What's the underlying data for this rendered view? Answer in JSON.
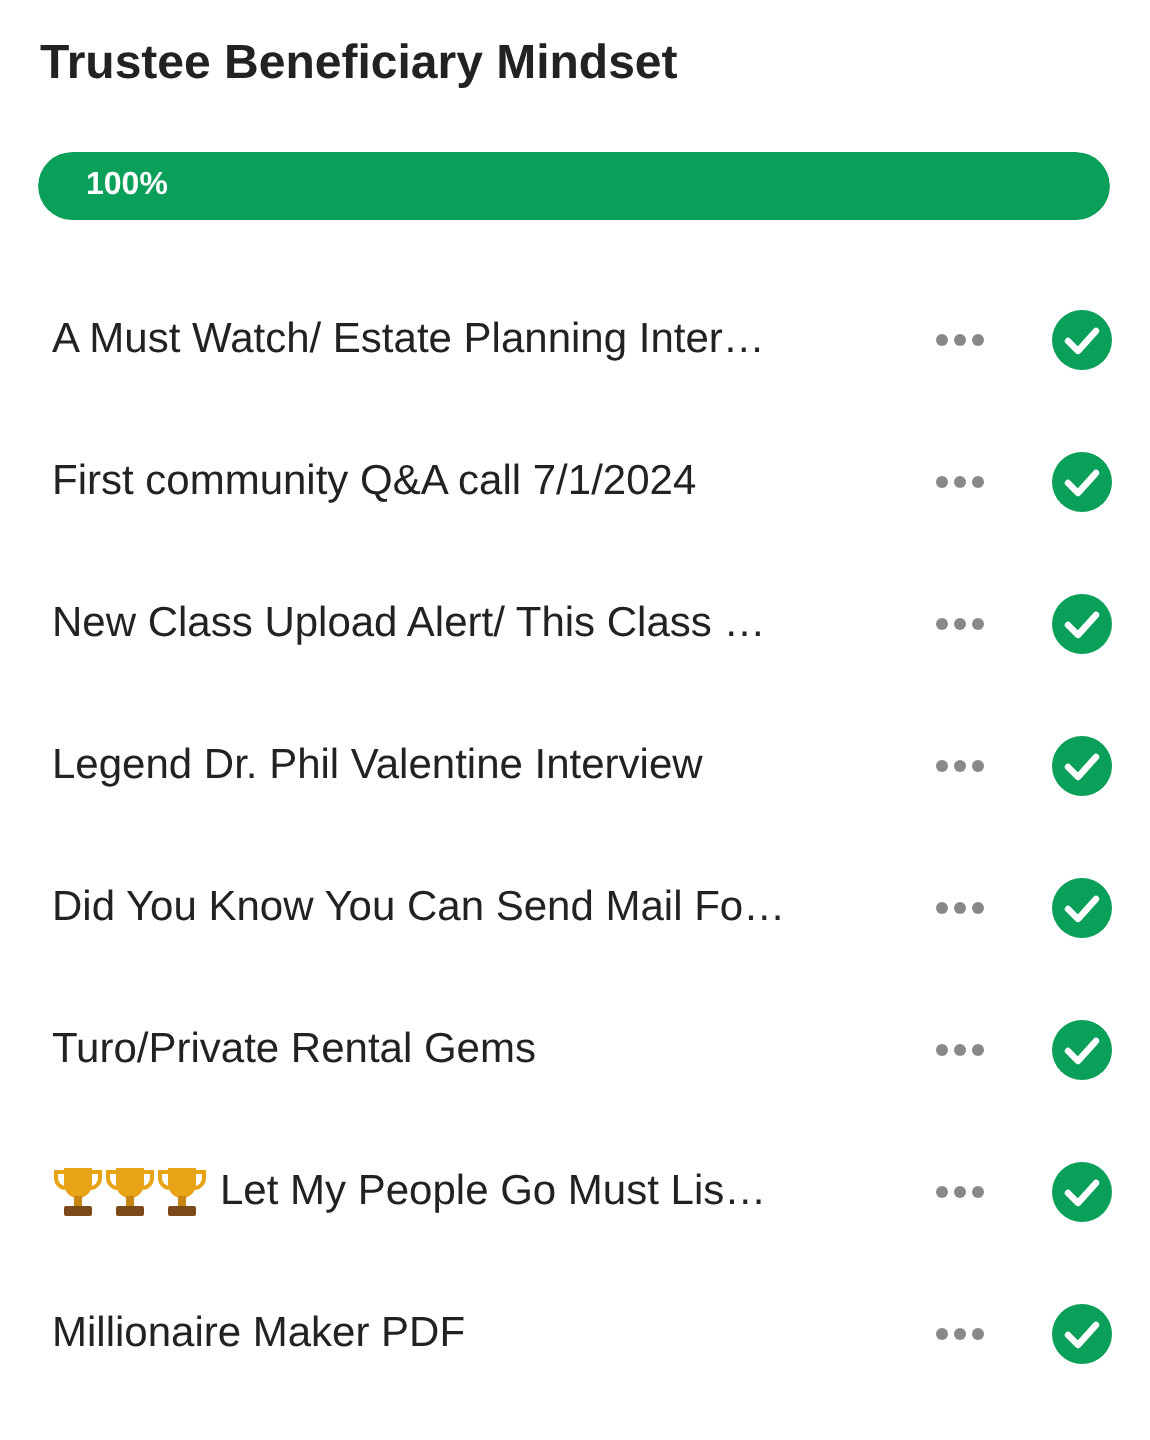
{
  "title": "Trustee Beneficiary Mindset",
  "progress": {
    "level": 1,
    "label": "100%"
  },
  "lessons": [
    {
      "kind": "plain",
      "title": "A Must Watch/ Estate Planning Inter…",
      "completed": true
    },
    {
      "kind": "plain",
      "title": "First community Q&A call 7/1/2024",
      "completed": true
    },
    {
      "kind": "plain",
      "title": "New Class Upload Alert/ This Class …",
      "completed": true
    },
    {
      "kind": "plain",
      "title": "Legend Dr. Phil Valentine Interview",
      "completed": true
    },
    {
      "kind": "plain",
      "title": "Did You Know You Can Send Mail Fo…",
      "completed": true
    },
    {
      "kind": "plain",
      "title": "Turo/Private Rental Gems",
      "completed": true
    },
    {
      "kind": "trophies",
      "title": "Let My People Go Must Lis…",
      "completed": true
    },
    {
      "kind": "plain",
      "title": "Millionaire Maker PDF",
      "completed": true
    }
  ]
}
